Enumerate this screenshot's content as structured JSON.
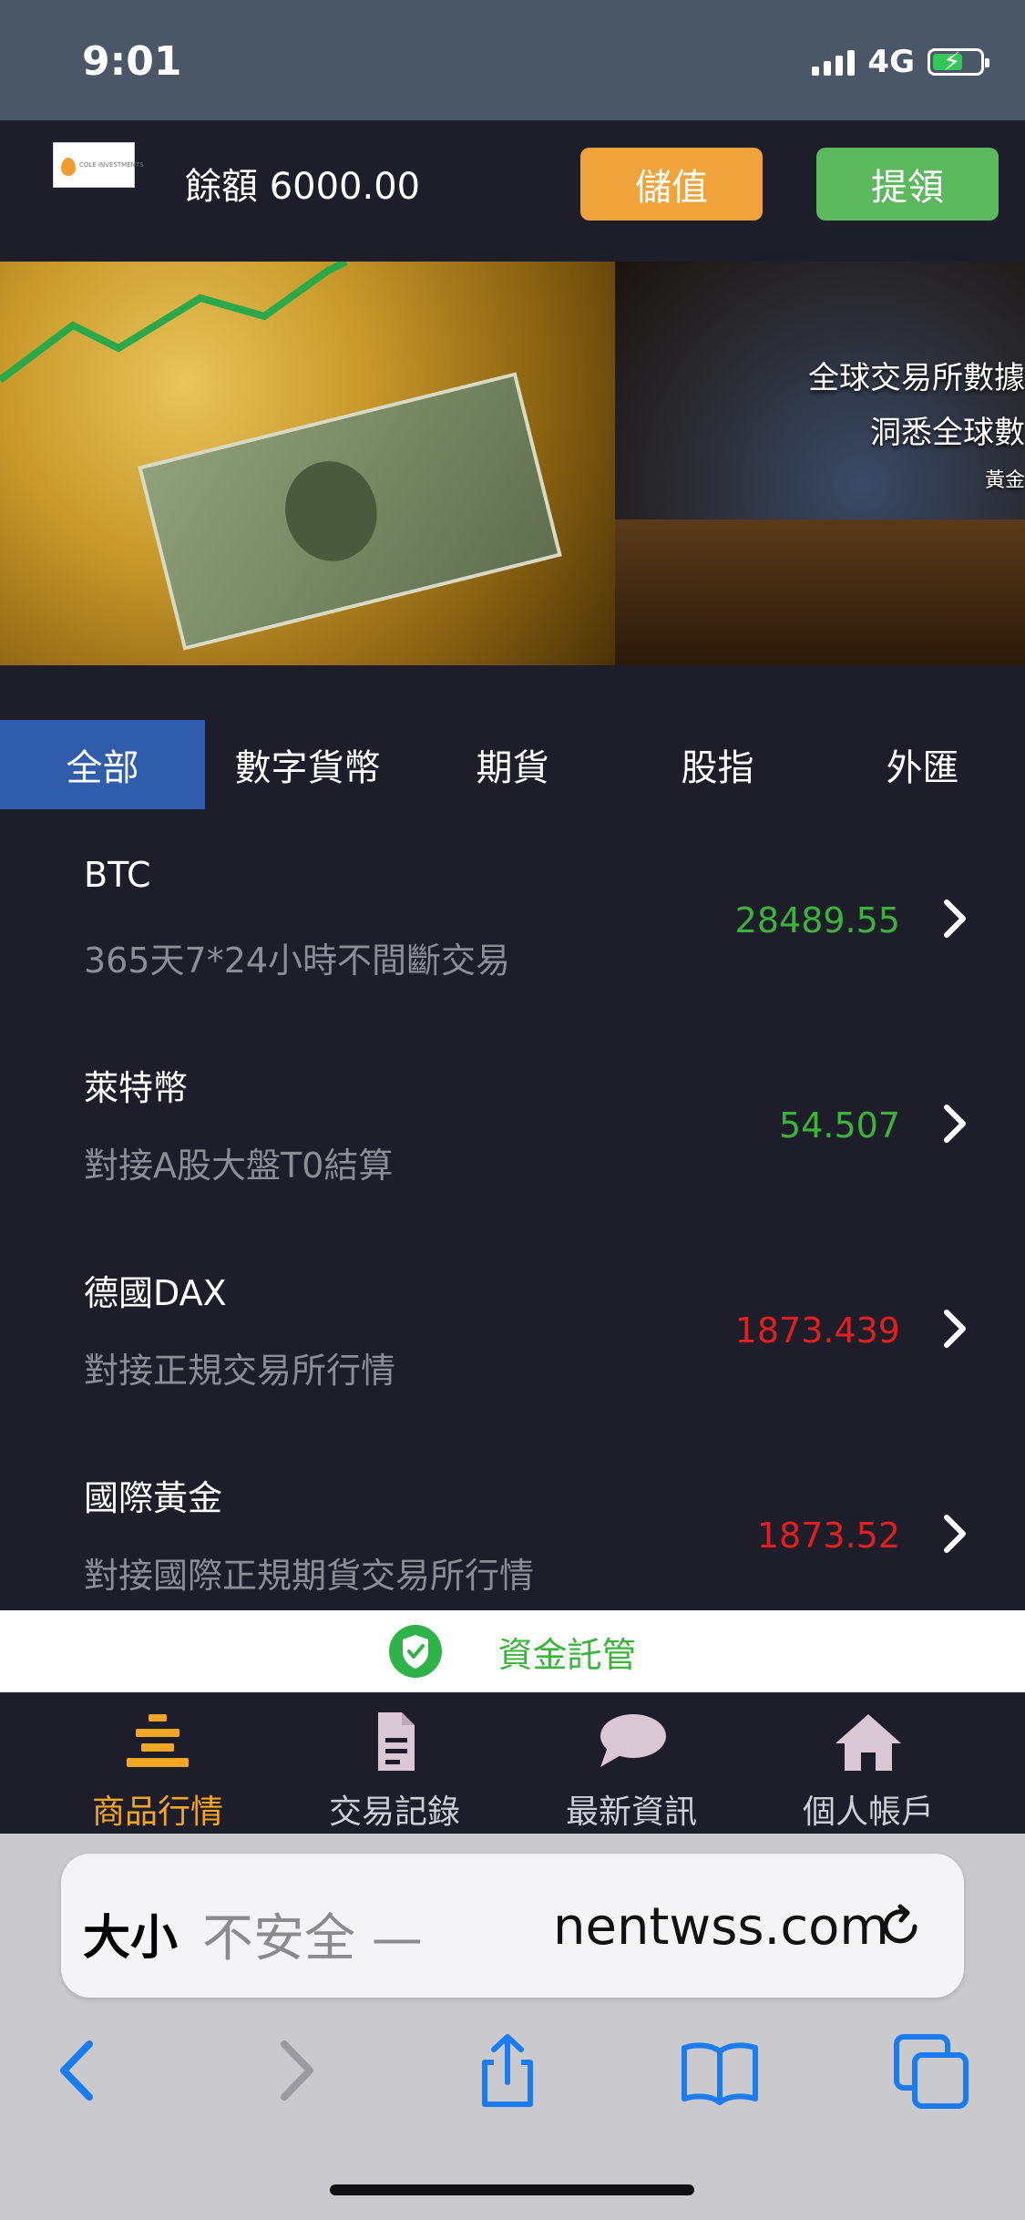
{
  "status_bar": {
    "time": "9:01",
    "network": "4G"
  },
  "header": {
    "balance": "餘額 6000.00",
    "deposit_label": "儲值",
    "withdraw_label": "提領"
  },
  "banner": {
    "line1": "全球交易所數據",
    "line2": "洞悉全球數",
    "line3": "黃金"
  },
  "tabs": [
    {
      "label": "全部",
      "active": true
    },
    {
      "label": "數字貨幣",
      "active": false
    },
    {
      "label": "期貨",
      "active": false
    },
    {
      "label": "股指",
      "active": false
    },
    {
      "label": "外匯",
      "active": false
    }
  ],
  "markets": [
    {
      "name": "BTC",
      "desc": "365天7*24小時不間斷交易",
      "price": "28489.55",
      "trend": "up"
    },
    {
      "name": "萊特幣",
      "desc": "對接A股大盤T0結算",
      "price": "54.507",
      "trend": "up"
    },
    {
      "name": "德國DAX",
      "desc": "對接正規交易所行情",
      "price": "1873.439",
      "trend": "down"
    },
    {
      "name": "國際黃金",
      "desc": "對接國際正規期貨交易所行情",
      "price": "1873.52",
      "trend": "down"
    }
  ],
  "escrow": {
    "label": "資金託管"
  },
  "bottom_nav": [
    {
      "label": "商品行情",
      "icon": "market-list-icon",
      "active": true
    },
    {
      "label": "交易記錄",
      "icon": "document-icon",
      "active": false
    },
    {
      "label": "最新資訊",
      "icon": "chat-bubble-icon",
      "active": false
    },
    {
      "label": "個人帳戶",
      "icon": "home-icon",
      "active": false
    }
  ],
  "safari": {
    "text_size": "大小",
    "insecure": "不安全 —",
    "domain": "nentwss.com"
  },
  "colors": {
    "up": "#3cb43c",
    "down": "#e02020",
    "accent_tab": "#2f5dac",
    "deposit": "#f0a33a",
    "withdraw": "#5cb85c",
    "nav_active": "#f5a623",
    "safari_blue": "#1a7cf0"
  }
}
